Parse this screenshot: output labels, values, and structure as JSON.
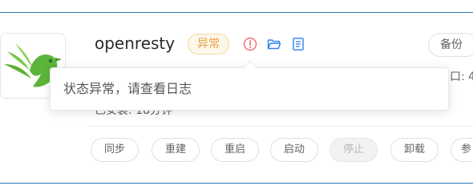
{
  "app": {
    "name": "openresty",
    "status_badge": "异常",
    "backup_label": "备份",
    "port_label": "口: 4",
    "installed_label": "已安装:   18分钟"
  },
  "tooltip": {
    "text": "状态异常，请查看日志"
  },
  "actions": {
    "sync": "同步",
    "rebuild": "重建",
    "restart": "重启",
    "start": "启动",
    "stop": "停止",
    "uninstall": "卸载",
    "params": "参"
  },
  "colors": {
    "accent_line": "#2c76b7",
    "badge_text": "#e6a23c",
    "badge_bg": "#fdf6ea",
    "warn_icon": "#f56c6c",
    "action_icon": "#409eff",
    "logo_green": "#6cbf3f"
  },
  "icons": {
    "warning": "warning-circle-icon",
    "folder": "folder-open-icon",
    "log": "document-log-icon"
  }
}
